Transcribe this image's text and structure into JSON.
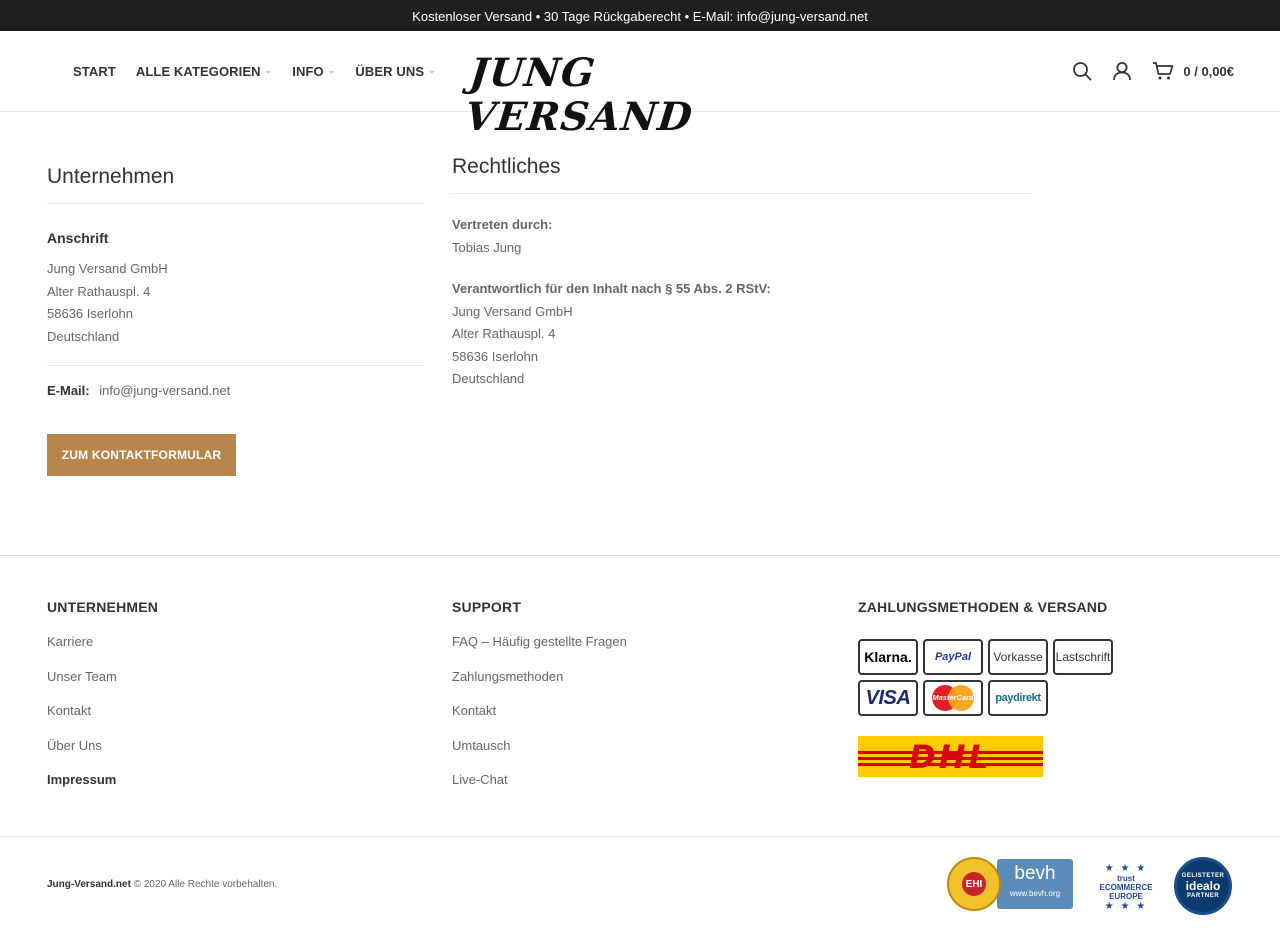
{
  "topbar": {
    "text": "Kostenloser Versand • 30 Tage Rückgaberecht • E-Mail: info@jung-versand.net"
  },
  "header": {
    "nav": [
      {
        "label": "START",
        "has_dropdown": false
      },
      {
        "label": "ALLE KATEGORIEN",
        "has_dropdown": true
      },
      {
        "label": "INFO",
        "has_dropdown": true
      },
      {
        "label": "ÜBER UNS",
        "has_dropdown": true
      }
    ],
    "logo": "JUNG VERSAND",
    "cart_amount": "0 / 0,00€",
    "icons": [
      "search-icon",
      "user-icon",
      "cart-icon"
    ]
  },
  "company": {
    "title": "Unternehmen",
    "address_heading": "Anschrift",
    "address": [
      "Jung Versand GmbH",
      "Alter Rathauspl. 4",
      "58636 Iserlohn",
      "Deutschland"
    ],
    "email_label": "E-Mail:",
    "email": "info@jung-versand.net",
    "contact_button": "ZUM KONTAKTFORMULAR"
  },
  "legal": {
    "title": "Rechtliches",
    "represented_label": "Vertreten durch:",
    "represented_by": "Tobias Jung",
    "responsible_label": "Verantwortlich für den Inhalt nach § 55 Abs. 2 RStV:",
    "responsible": [
      "Jung Versand GmbH",
      "Alter Rathauspl. 4",
      "58636 Iserlohn",
      "Deutschland"
    ]
  },
  "footer": {
    "company": {
      "title": "UNTERNEHMEN",
      "links": [
        "Karriere",
        "Unser Team",
        "Kontakt",
        "Über Uns",
        "Impressum"
      ],
      "active": "Impressum"
    },
    "support": {
      "title": "SUPPORT",
      "links": [
        "FAQ – Häufig gestellte Fragen",
        "Zahlungsmethoden",
        "Kontakt",
        "Umtausch",
        "Live-Chat"
      ]
    },
    "payment": {
      "title": "ZAHLUNGSMETHODEN & VERSAND",
      "methods": [
        "Klarna.",
        "PayPal",
        "Vorkasse",
        "Lastschrift",
        "VISA",
        "MasterCard",
        "paydirekt"
      ],
      "shipping": "DHL"
    }
  },
  "bottom": {
    "brand": "Jung-Versand.net",
    "copyright": "© 2020 Alle Rechte vorbehalten.",
    "badges": {
      "ehi": {
        "seal": "EHI",
        "bevh": "bevh",
        "bevh_url": "www.bevh.org"
      },
      "ecommerce": {
        "top": "trust",
        "line1": "ECOMMERCE",
        "line2": "EUROPE"
      },
      "idealo": {
        "top": "GELISTETER",
        "name": "idealo",
        "bottom": "PARTNER"
      }
    }
  },
  "colors": {
    "accent": "#b8864c",
    "topbar": "#1f1f1f",
    "dhl_yellow": "#ffcc00",
    "dhl_red": "#d40511"
  }
}
